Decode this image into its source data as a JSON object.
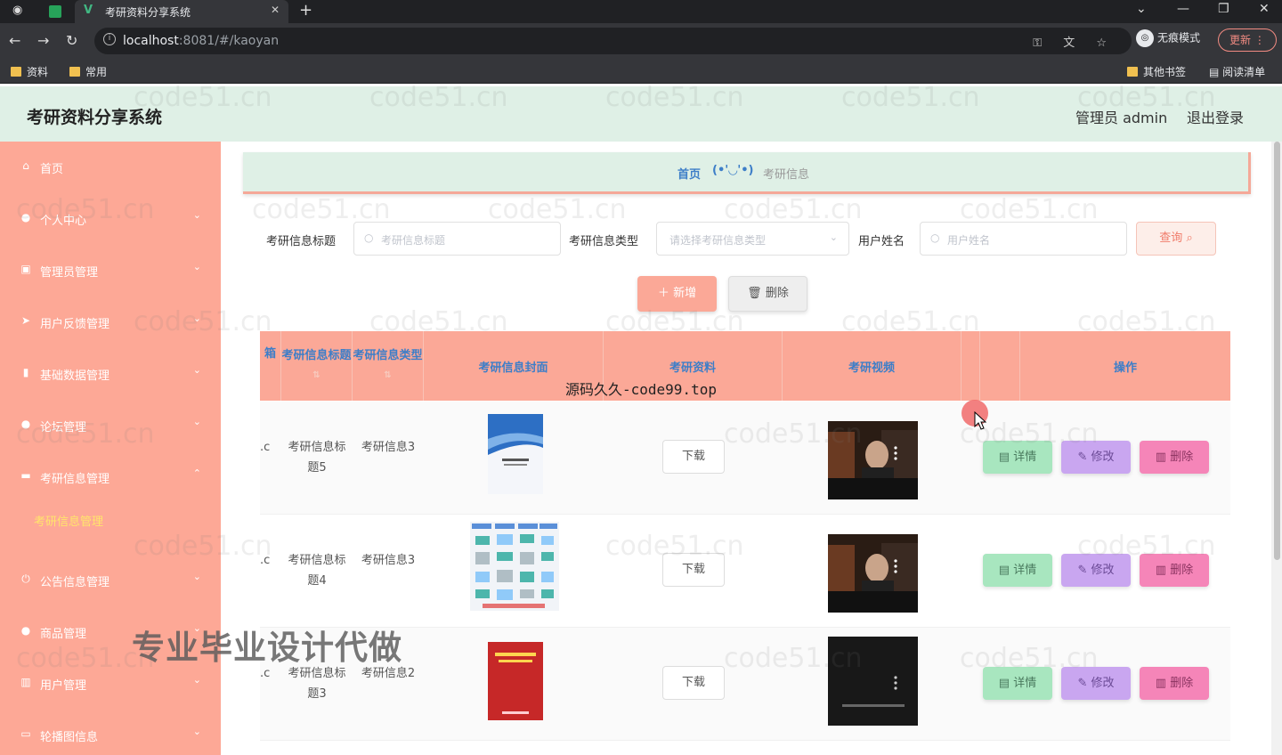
{
  "browser": {
    "tab_title": "考研资料分享系统",
    "url_host": "localhost",
    "url_rest": ":8081/#/kaoyan",
    "incognito_label": "无痕模式",
    "update_label": "更新",
    "bookmarks": [
      "资料",
      "常用"
    ],
    "bookmarks_right": [
      "其他书签",
      "阅读清单"
    ]
  },
  "header": {
    "title": "考研资料分享系统",
    "admin": "管理员 admin",
    "logout": "退出登录"
  },
  "sidebar": {
    "items": [
      {
        "label": "首页",
        "icon": "home-icon"
      },
      {
        "label": "个人中心",
        "icon": "user-icon"
      },
      {
        "label": "管理员管理",
        "icon": "folder-icon"
      },
      {
        "label": "用户反馈管理",
        "icon": "send-icon"
      },
      {
        "label": "基础数据管理",
        "icon": "bulb-icon"
      },
      {
        "label": "论坛管理",
        "icon": "lightbulb-icon"
      },
      {
        "label": "考研信息管理",
        "icon": "chat-icon"
      },
      {
        "label": "公告信息管理",
        "icon": "power-icon"
      },
      {
        "label": "商品管理",
        "icon": "person-icon"
      },
      {
        "label": "用户管理",
        "icon": "bar-chart-icon"
      },
      {
        "label": "轮播图信息",
        "icon": "message-icon"
      }
    ],
    "active_sub": "考研信息管理"
  },
  "breadcrumb": {
    "home": "首页",
    "separator": "(•'◡'•)",
    "current": "考研信息"
  },
  "filters": {
    "title_label": "考研信息标题",
    "title_placeholder": "考研信息标题",
    "type_label": "考研信息类型",
    "type_placeholder": "请选择考研信息类型",
    "name_label": "用户姓名",
    "name_placeholder": "用户姓名",
    "query_label": "查询"
  },
  "actions": {
    "add_label": "新增",
    "delete_label": "删除"
  },
  "table": {
    "headers": [
      "箱",
      "考研信息标题",
      "考研信息类型",
      "考研信息封面",
      "考研资料",
      "考研视频",
      "操作"
    ],
    "rows": [
      {
        "c": ".c",
        "title": "考研信息标题5",
        "type": "考研信息3",
        "download": "下载"
      },
      {
        "c": ".c",
        "title": "考研信息标题4",
        "type": "考研信息3",
        "download": "下载"
      },
      {
        "c": ".c",
        "title": "考研信息标题3",
        "type": "考研信息2",
        "download": "下载"
      }
    ],
    "btn_detail": "详情",
    "btn_edit": "修改",
    "btn_delete": "删除"
  },
  "overlays": {
    "watermark": "code51.cn",
    "ad_source": "源码久久-code99.top",
    "ad_service": "专业毕业设计代做"
  }
}
